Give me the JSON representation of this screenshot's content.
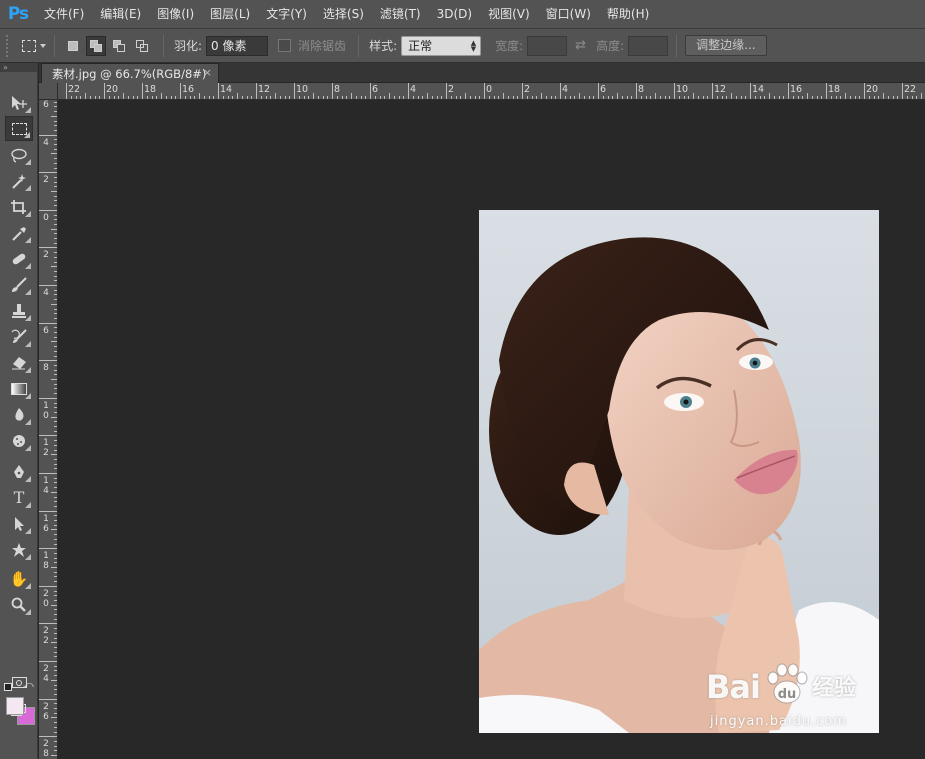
{
  "app": {
    "logo": "Ps"
  },
  "menu": [
    "文件(F)",
    "编辑(E)",
    "图像(I)",
    "图层(L)",
    "文字(Y)",
    "选择(S)",
    "滤镜(T)",
    "3D(D)",
    "视图(V)",
    "窗口(W)",
    "帮助(H)"
  ],
  "options": {
    "feather_label": "羽化:",
    "feather_value": "0 像素",
    "antialias_label": "消除锯齿",
    "style_label": "样式:",
    "style_value": "正常",
    "width_label": "宽度:",
    "height_label": "高度:",
    "refine_edge_label": "调整边缘..."
  },
  "document": {
    "tab_title": "素材.jpg @ 66.7%(RGB/8#)",
    "close_glyph": "×"
  },
  "rulers": {
    "top_labels": [
      "22",
      "20",
      "18",
      "16",
      "14",
      "12",
      "10",
      "8",
      "6",
      "4",
      "2",
      "0",
      "2",
      "4",
      "6",
      "8",
      "10",
      "12",
      "14",
      "16",
      "18",
      "20",
      "22"
    ],
    "left_labels": [
      "6",
      "4",
      "2",
      "0",
      "2",
      "4",
      "6",
      "8",
      "10",
      "12",
      "14",
      "16",
      "18",
      "20",
      "22",
      "24",
      "26",
      "28"
    ]
  },
  "tools": [
    "move-tool",
    "rectangular-marquee-tool",
    "lasso-tool",
    "magic-wand-tool",
    "crop-tool",
    "eyedropper-tool",
    "spot-healing-tool",
    "brush-tool",
    "clone-stamp-tool",
    "history-brush-tool",
    "eraser-tool",
    "gradient-tool",
    "blur-tool",
    "dodge-tool",
    "pen-tool",
    "type-tool",
    "path-selection-tool",
    "custom-shape-tool",
    "hand-tool",
    "zoom-tool"
  ],
  "colors": {
    "foreground": "#f3e8f1",
    "background": "#d86ad8",
    "accent": "#2fa3f5"
  },
  "watermark": {
    "brand": "Bai",
    "brand_cn": "经验",
    "url": "jingyan.baidu.com"
  }
}
